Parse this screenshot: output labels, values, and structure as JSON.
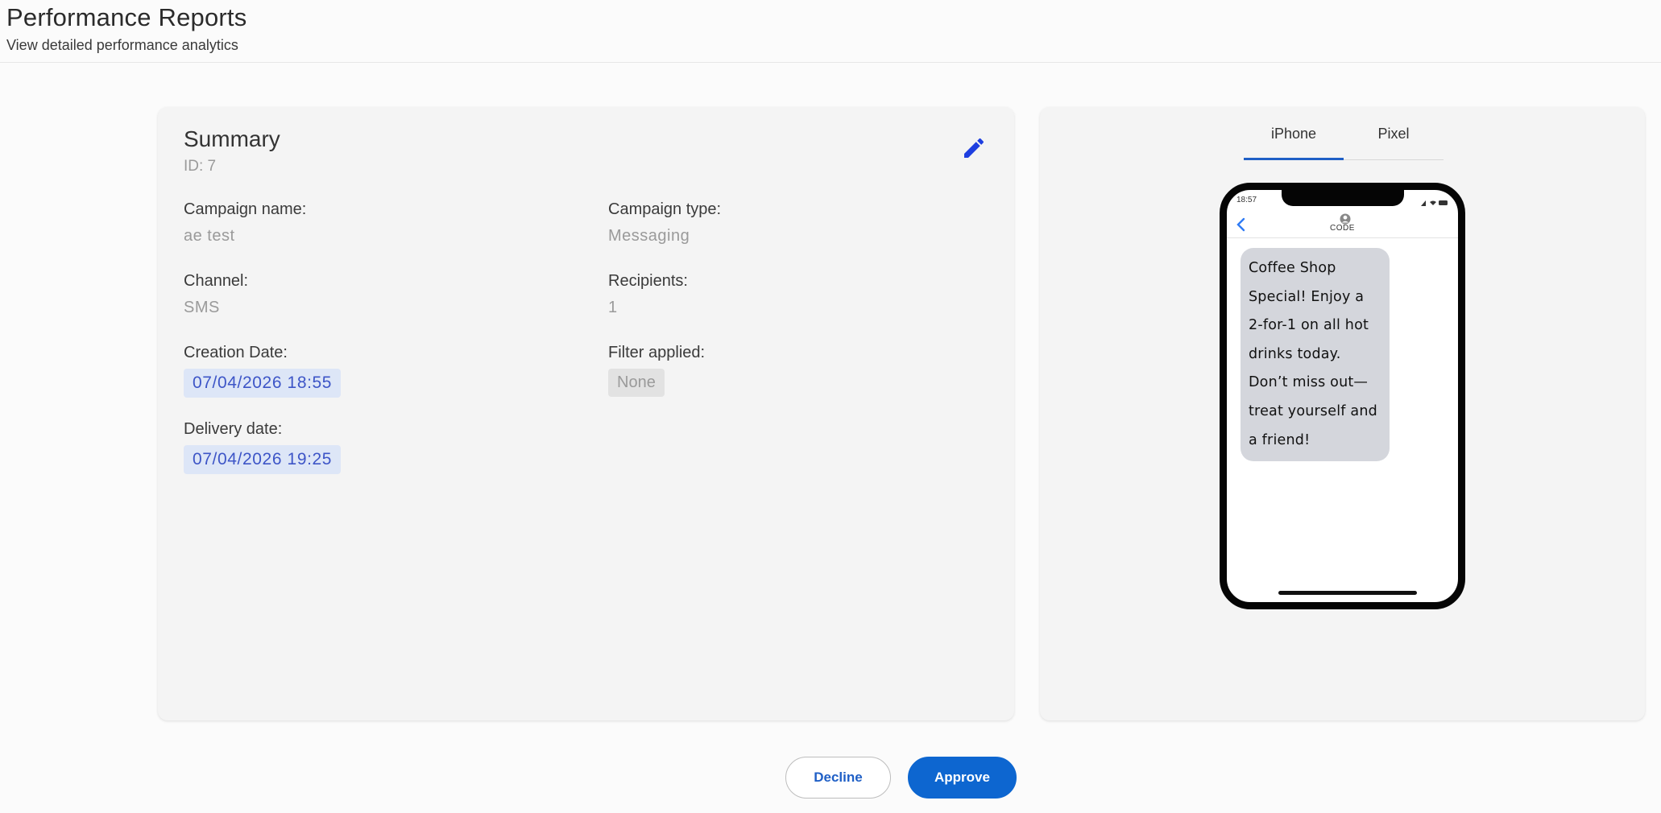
{
  "header": {
    "title": "Performance Reports",
    "subtitle": "View detailed performance analytics"
  },
  "summary": {
    "title": "Summary",
    "id_text": "ID: 7",
    "fields": {
      "campaign_name": {
        "label": "Campaign name:",
        "value": "ae test"
      },
      "campaign_type": {
        "label": "Campaign type:",
        "value": "Messaging"
      },
      "channel": {
        "label": "Channel:",
        "value": "SMS"
      },
      "recipients": {
        "label": "Recipients:",
        "value": "1"
      },
      "creation_date": {
        "label": "Creation Date:",
        "value": "07/04/2026 18:55"
      },
      "filter_applied": {
        "label": "Filter applied:",
        "value": "None"
      },
      "delivery_date": {
        "label": "Delivery date:",
        "value": "07/04/2026 19:25"
      }
    },
    "edit_icon": "pencil-icon"
  },
  "preview": {
    "tabs": [
      {
        "label": "iPhone",
        "active": true
      },
      {
        "label": "Pixel",
        "active": false
      }
    ],
    "phone": {
      "status_time": "18:57",
      "contact_name": "CODE",
      "message": "Coffee Shop Special! Enjoy a 2-for-1 on all hot drinks today. Don’t miss out—treat yourself and a friend!"
    }
  },
  "actions": {
    "decline_label": "Decline",
    "approve_label": "Approve"
  },
  "colors": {
    "accent": "#0d66d0",
    "date_chip_bg": "#dde6f7",
    "date_chip_text": "#3d55c7",
    "bubble": "#d4d6dc"
  }
}
